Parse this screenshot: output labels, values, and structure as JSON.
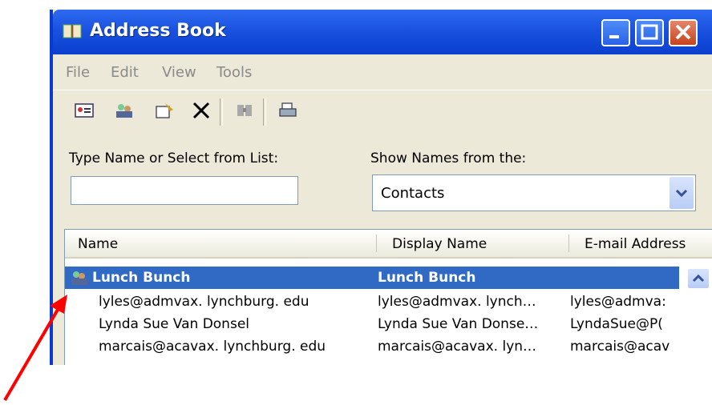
{
  "window": {
    "title": "Address Book",
    "title_icon": "address-book-icon",
    "buttons": {
      "minimize": "minimize-icon",
      "maximize": "maximize-icon",
      "close": "close-icon"
    }
  },
  "menu": [
    "File",
    "Edit",
    "View",
    "Tools"
  ],
  "toolbar": [
    "new-contact-icon",
    "new-group-icon",
    "properties-icon",
    "delete-icon",
    "find-people-icon",
    "print-icon"
  ],
  "search": {
    "label": "Type Name or Select from List:",
    "value": ""
  },
  "source": {
    "label": "Show Names from the:",
    "value": "Contacts"
  },
  "list": {
    "headers": [
      "Name",
      "Display Name",
      "E-mail Address"
    ],
    "rows": [
      {
        "name": "Lunch Bunch",
        "display": "Lunch Bunch",
        "email": "",
        "selected": true,
        "icon": "group-icon"
      },
      {
        "name": "lyles@admvax. lynchburg. edu",
        "display": "lyles@admvax. lynch…",
        "email": "lyles@admva:",
        "selected": false
      },
      {
        "name": "Lynda Sue Van Donsel",
        "display": "Lynda Sue Van Donse…",
        "email": "LyndaSue@P(",
        "selected": false
      },
      {
        "name": "marcais@acavax. lynchburg. edu",
        "display": "marcais@acavax. lyn…",
        "email": "marcais@acav",
        "selected": false
      }
    ]
  },
  "colors": {
    "titlebar": "#0b3fcf",
    "selection": "#316ac5",
    "arrow": "#ff0000"
  }
}
